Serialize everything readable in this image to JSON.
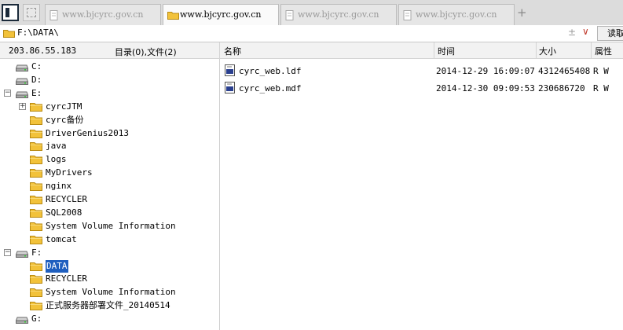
{
  "tabs": [
    {
      "label": "www.bjcyrc.gov.cn",
      "active": false,
      "icon": "page-icon"
    },
    {
      "label": "www.bjcyrc.gov.cn",
      "active": true,
      "icon": "folder-icon"
    },
    {
      "label": "www.bjcyrc.gov.cn",
      "active": false,
      "icon": "page-icon"
    },
    {
      "label": "www.bjcyrc.gov.cn",
      "active": false,
      "icon": "page-icon"
    }
  ],
  "new_tab_label": "+",
  "address": {
    "path": "F:\\DATA\\",
    "pin_glyph": "±",
    "dropdown_glyph": "∨",
    "read_button": "读取"
  },
  "info": {
    "ip": "203.86.55.183",
    "counts": "目录(0),文件(2)"
  },
  "columns": {
    "name": "名称",
    "time": "时间",
    "size": "大小",
    "attr": "属性"
  },
  "tree": [
    {
      "label": "C:",
      "type": "drive",
      "level": 0,
      "expander": "none",
      "selected": false
    },
    {
      "label": "D:",
      "type": "drive",
      "level": 0,
      "expander": "none",
      "selected": false
    },
    {
      "label": "E:",
      "type": "drive",
      "level": 0,
      "expander": "minus",
      "selected": false
    },
    {
      "label": "cyrcJTM",
      "type": "folder",
      "level": 1,
      "expander": "plus",
      "selected": false
    },
    {
      "label": "cyrc备份",
      "type": "folder",
      "level": 1,
      "expander": "none",
      "selected": false
    },
    {
      "label": "DriverGenius2013",
      "type": "folder",
      "level": 1,
      "expander": "none",
      "selected": false
    },
    {
      "label": "java",
      "type": "folder",
      "level": 1,
      "expander": "none",
      "selected": false
    },
    {
      "label": "logs",
      "type": "folder",
      "level": 1,
      "expander": "none",
      "selected": false
    },
    {
      "label": "MyDrivers",
      "type": "folder",
      "level": 1,
      "expander": "none",
      "selected": false
    },
    {
      "label": "nginx",
      "type": "folder",
      "level": 1,
      "expander": "none",
      "selected": false
    },
    {
      "label": "RECYCLER",
      "type": "folder",
      "level": 1,
      "expander": "none",
      "selected": false
    },
    {
      "label": "SQL2008",
      "type": "folder",
      "level": 1,
      "expander": "none",
      "selected": false
    },
    {
      "label": "System Volume Information",
      "type": "folder",
      "level": 1,
      "expander": "none",
      "selected": false
    },
    {
      "label": "tomcat",
      "type": "folder",
      "level": 1,
      "expander": "none",
      "selected": false
    },
    {
      "label": "F:",
      "type": "drive",
      "level": 0,
      "expander": "minus",
      "selected": false
    },
    {
      "label": "DATA",
      "type": "folder",
      "level": 1,
      "expander": "none",
      "selected": true
    },
    {
      "label": "RECYCLER",
      "type": "folder",
      "level": 1,
      "expander": "none",
      "selected": false
    },
    {
      "label": "System Volume Information",
      "type": "folder",
      "level": 1,
      "expander": "none",
      "selected": false
    },
    {
      "label": "正式服务器部署文件_20140514",
      "type": "folder",
      "level": 1,
      "expander": "none",
      "selected": false
    },
    {
      "label": "G:",
      "type": "drive",
      "level": 0,
      "expander": "none",
      "selected": false
    }
  ],
  "files": [
    {
      "name": "cyrc_web.ldf",
      "time": "2014-12-29 16:09:07",
      "size": "4312465408",
      "attr": "R W",
      "icon": "database-file-icon"
    },
    {
      "name": "cyrc_web.mdf",
      "time": "2014-12-30 09:09:53",
      "size": "230686720",
      "attr": "R W",
      "icon": "database-file-icon"
    }
  ],
  "colors": {
    "selection": "#1f5fbf",
    "folder": "#f2c23a",
    "file_icon": "#2a3f8f"
  }
}
